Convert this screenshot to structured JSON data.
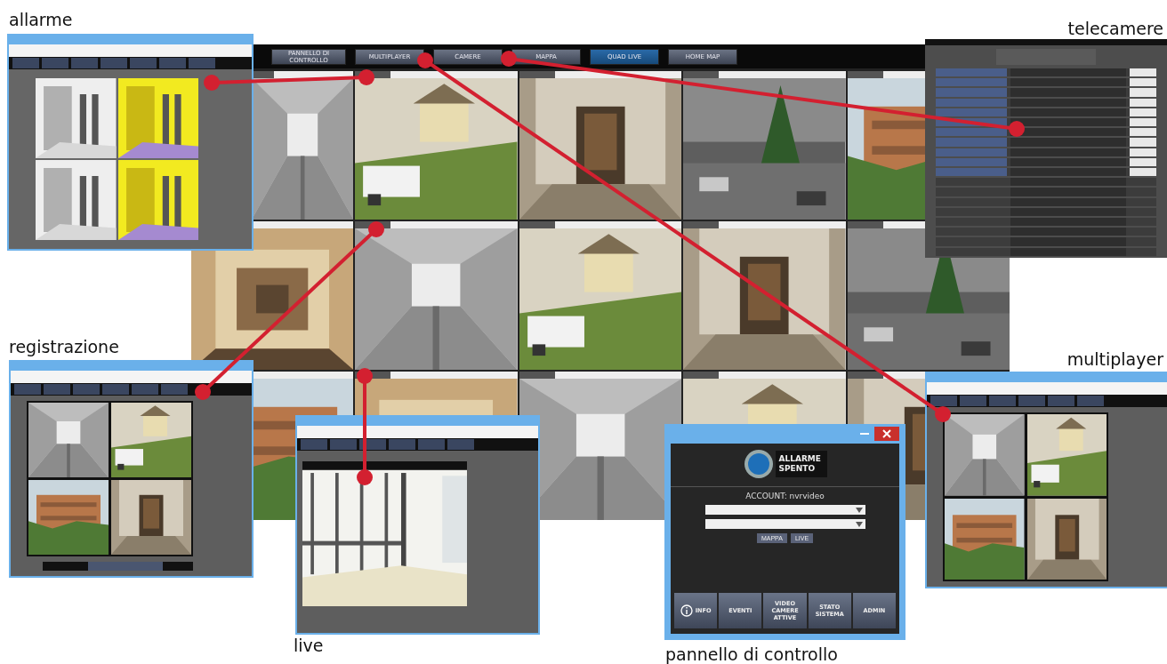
{
  "callouts": [
    {
      "label": "allarme"
    },
    {
      "label": "telecamere"
    },
    {
      "label": "registrazione"
    },
    {
      "label": "multiplayer"
    },
    {
      "label": "live"
    },
    {
      "label": "pannello di controllo"
    }
  ],
  "main_window": {
    "menu": [
      {
        "label": "PANNELLO DI CONTROLLO",
        "selected": false
      },
      {
        "label": "MULTIPLAYER",
        "selected": false
      },
      {
        "label": "CAMERE",
        "selected": false
      },
      {
        "label": "MAPPA",
        "selected": false
      },
      {
        "label": "QUAD LIVE",
        "selected": true
      },
      {
        "label": "HOME MAP",
        "selected": false
      }
    ]
  },
  "control_panel": {
    "status": "ALLARME SPENTO",
    "account": "ACCOUNT: nvrvideo",
    "buttons": [
      "MAPPA",
      "LIVE"
    ],
    "menu": [
      {
        "label": "INFO",
        "kind": "icon"
      },
      {
        "label": "EVENTI",
        "kind": "text"
      },
      {
        "label": "VIDEO CAMERE ATTIVE",
        "kind": "text"
      },
      {
        "label": "STATO SISTEMA",
        "kind": "text"
      },
      {
        "label": "ADMIN",
        "kind": "text"
      }
    ]
  }
}
